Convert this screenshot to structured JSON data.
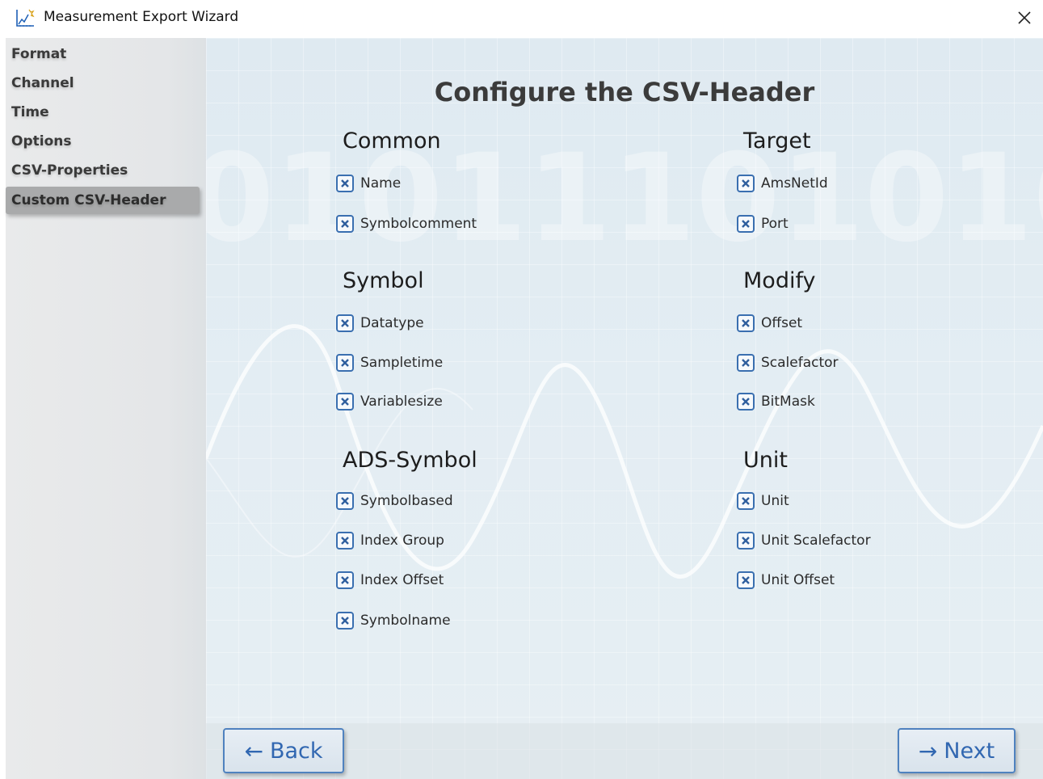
{
  "window": {
    "title": "Measurement Export Wizard",
    "close_icon": "close-icon"
  },
  "sidebar": {
    "items": [
      {
        "label": "Format"
      },
      {
        "label": "Channel"
      },
      {
        "label": "Time"
      },
      {
        "label": "Options"
      },
      {
        "label": "CSV-Properties"
      },
      {
        "label": "Custom CSV-Header",
        "active": true
      }
    ]
  },
  "main": {
    "title": "Configure the CSV-Header",
    "sections": {
      "common": {
        "title": "Common",
        "options": [
          {
            "label": "Name",
            "checked": true
          },
          {
            "label": "Symbolcomment",
            "checked": true
          }
        ]
      },
      "target": {
        "title": "Target",
        "options": [
          {
            "label": "AmsNetId",
            "checked": true
          },
          {
            "label": "Port",
            "checked": true
          }
        ]
      },
      "symbol": {
        "title": "Symbol",
        "options": [
          {
            "label": "Datatype",
            "checked": true
          },
          {
            "label": "Sampletime",
            "checked": true
          },
          {
            "label": "Variablesize",
            "checked": true
          }
        ]
      },
      "modify": {
        "title": "Modify",
        "options": [
          {
            "label": "Offset",
            "checked": true
          },
          {
            "label": "Scalefactor",
            "checked": true
          },
          {
            "label": "BitMask",
            "checked": true
          }
        ]
      },
      "ads_symbol": {
        "title": "ADS-Symbol",
        "options": [
          {
            "label": "Symbolbased",
            "checked": true
          },
          {
            "label": "Index Group",
            "checked": true
          },
          {
            "label": "Index Offset",
            "checked": true
          },
          {
            "label": "Symbolname",
            "checked": true
          }
        ]
      },
      "unit": {
        "title": "Unit",
        "options": [
          {
            "label": "Unit",
            "checked": true
          },
          {
            "label": "Unit Scalefactor",
            "checked": true
          },
          {
            "label": "Unit Offset",
            "checked": true
          }
        ]
      }
    }
  },
  "footer": {
    "back_label": "Back",
    "next_label": "Next"
  },
  "colors": {
    "accent": "#3a6fb0",
    "sidebar_active": "#a9aaab",
    "main_bg": "#e2ecf2"
  }
}
